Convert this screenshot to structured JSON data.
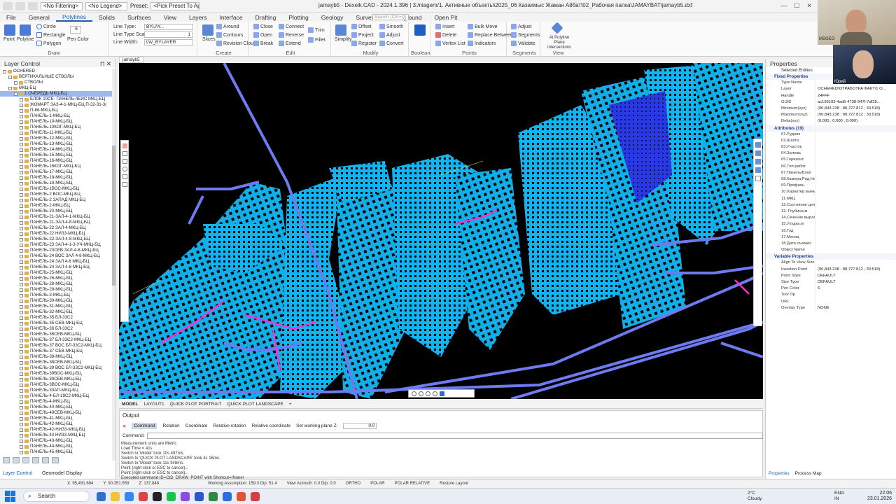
{
  "window": {
    "title": "jamayb5 - Dexeik.CAD - 2024.1.396 | 3:/niagem/1. Активные объекты\\2025_06 Казахмыс Жаман Айбат\\02_Рабочая папка\\JAMAYBAT\\jamayb5.dxf",
    "filter_label": "<No Filtering>",
    "legend_label": "<No Legend>",
    "preset_label": "Preset:",
    "preset_value": "<Pick Preset To Ap...",
    "search_placeholder": "Search (Ctrl+Q)"
  },
  "menu": {
    "items": [
      "File",
      "General",
      "Polylines",
      "Solids",
      "Surfaces",
      "View",
      "Layers",
      "Interface",
      "Drafting",
      "Plotting",
      "Geology",
      "Survey",
      "Underground",
      "Open Pit"
    ],
    "active": "Polylines"
  },
  "ribbon": {
    "draw": {
      "title": "Draw",
      "items": [
        "Point",
        "Polyline",
        "Circle",
        "Rectangle",
        "Polygon",
        "Pen Color"
      ],
      "pen_color_value": "6"
    },
    "linetype": {
      "line_type_label": "Line Type:",
      "line_type_value": "BYLAY...",
      "line_type_scale_label": "Line Type Scale:",
      "line_type_scale_value": "1",
      "line_width_label": "Line Width:",
      "line_width_value": "LW_BYLAYER"
    },
    "create": {
      "title": "Create",
      "items": [
        "Slices",
        "Around",
        "Contours",
        "Revision Cloud"
      ]
    },
    "edit": {
      "title": "Edit",
      "items": [
        "Close",
        "Open",
        "Break",
        "Connect",
        "Reverse",
        "Extend",
        "Trim",
        "Fillet"
      ]
    },
    "modify": {
      "title": "Modify",
      "items": [
        "Simplify",
        "Offset",
        "Project",
        "Register",
        "Smooth",
        "Adjust",
        "Convert"
      ]
    },
    "boolean": {
      "title": "Boolean",
      "items": [
        "Boolean"
      ]
    },
    "points": {
      "title": "Points",
      "items": [
        "Insert",
        "Delete",
        "Vertex List",
        "Bulk Move",
        "Replace Between",
        "Indicators"
      ]
    },
    "segments": {
      "title": "Segments",
      "items": [
        "Adjust",
        "Segments",
        "Validate"
      ]
    },
    "view": {
      "title": "View",
      "items": [
        "At Polyline Plane Intersections"
      ]
    }
  },
  "layer_control": {
    "title": "Layer Control",
    "tree": [
      {
        "label": "OCHERED",
        "indent": 0
      },
      {
        "label": "ВЕРТИКАЛЬНЫЕ СТВОЛЫ",
        "indent": 1
      },
      {
        "label": "СТВОЛЫ",
        "indent": 2
      },
      {
        "label": "МКЦ-БЦ",
        "indent": 1
      },
      {
        "label": "1 ОЧЕРЕДЬ МКЦ-БЦ",
        "indent": 2,
        "selected": true
      },
      {
        "label": "БЛОК 10СЕ- ПАНЕЛЬ-4БИС МКЦ-БЦ",
        "indent": 3
      },
      {
        "label": "ЖОМАРТ ЗАЗ-4-1-МКЦ-БЦ П-32-31-3(",
        "indent": 3
      },
      {
        "label": "П-86-МКЦ-БЦ",
        "indent": 3
      },
      {
        "label": "ПАНЕЛЬ-1-МКЦ-БЦ",
        "indent": 3
      },
      {
        "label": "ПАНЕЛЬ-10-МКЦ-БЦ",
        "indent": 3
      },
      {
        "label": "ПАНЕЛЬ-10КОГ-МКЦ-БЦ",
        "indent": 3
      },
      {
        "label": "ПАНЕЛЬ-11-МКЦ-БЦ",
        "indent": 3
      },
      {
        "label": "ПАНЕЛЬ-12-МКЦ-БЦ",
        "indent": 3
      },
      {
        "label": "ПАНЕЛЬ-13-МКЦ-БЦ",
        "indent": 3
      },
      {
        "label": "ПАНЕЛЬ-14-МКЦ-БЦ",
        "indent": 3
      },
      {
        "label": "ПАНЕЛЬ-15-МКЦ-БЦ",
        "indent": 3
      },
      {
        "label": "ПАНЕЛЬ-16-МКЦ-БЦ",
        "indent": 3
      },
      {
        "label": "ПАНЕЛЬ-16КОГ-МКЦ-БЦ",
        "indent": 3
      },
      {
        "label": "ПАНЕЛЬ-17-МКЦ-БЦ",
        "indent": 3
      },
      {
        "label": "ПАНЕЛЬ-18-МКЦ-БЦ",
        "indent": 3
      },
      {
        "label": "ПАНЕЛЬ-19-МКЦ-БЦ",
        "indent": 3
      },
      {
        "label": "ПАНЕЛЬ-1ВОС-МКЦ-БЦ",
        "indent": 3
      },
      {
        "label": "ПАНЕЛЬ-2 ВОС-МКЦ-БЦ",
        "indent": 3
      },
      {
        "label": "ПАНЕЛЬ-2 ЗАПАД МКЦ-БЦ",
        "indent": 3
      },
      {
        "label": "ПАНЕЛЬ-2-МКЦ-БЦ",
        "indent": 3
      },
      {
        "label": "ПАНЕЛЬ-20-МКЦ-БЦ",
        "indent": 3
      },
      {
        "label": "ПАНЕЛЬ-21-ЗАЛ-4-1-МКЦ-БЦ",
        "indent": 3
      },
      {
        "label": "ПАНЕЛЬ-21-ЗАЛ-4-8-МКЦ-БЦ",
        "indent": 3
      },
      {
        "label": "ПАНЕЛЬ-22 ЗАЛ-4-МКЦ-БЦ",
        "indent": 3
      },
      {
        "label": "ПАНЕЛЬ-22 НИЗ3-МКЦ-БЦ",
        "indent": 3
      },
      {
        "label": "ПАНЕЛЬ-22-ЗАЛ-4-8-МКЦ-БЦ",
        "indent": 3
      },
      {
        "label": "ПАНЕЛЬ-23 ЗАЛ-4-1-3-УЧ-МКЦ-БЦ",
        "indent": 3
      },
      {
        "label": "ПАНЕЛЬ-23СЕВ ЗАЛ-4-8-МКЦ-БЦ",
        "indent": 3
      },
      {
        "label": "ПАНЕЛЬ-24 ВОС ЗАЛ 4-8-МКЦ-БЦ",
        "indent": 3
      },
      {
        "label": "ПАНЕЛЬ-24 ЗАЛ 4-8 МКЦ-БЦ",
        "indent": 3
      },
      {
        "label": "ПАНЕЛЬ-24 ЗАЛ-4-8 МКЦ-БЦ",
        "indent": 3
      },
      {
        "label": "ПАНЕЛЬ-25-МКЦ-БЦ",
        "indent": 3
      },
      {
        "label": "ПАНЕЛЬ-26-МКЦ-БЦ",
        "indent": 3
      },
      {
        "label": "ПАНЕЛЬ-28-МКЦ-БЦ",
        "indent": 3
      },
      {
        "label": "ПАНЕЛЬ-29-МКЦ-БЦ",
        "indent": 3
      },
      {
        "label": "ПАНЕЛЬ-3-МКЦ-БЦ",
        "indent": 3
      },
      {
        "label": "ПАНЕЛЬ-30-МКЦ-БЦ",
        "indent": 3
      },
      {
        "label": "ПАНЕЛЬ-31-МКЦ-БЦ",
        "indent": 3
      },
      {
        "label": "ПАНЕЛЬ-32-МКЦ-БЦ",
        "indent": 3
      },
      {
        "label": "ПАНЕЛЬ-35 БЛ-33С2",
        "indent": 3
      },
      {
        "label": "ПАНЕЛЬ-35 СЕВ-МКЦ-БЦ",
        "indent": 3
      },
      {
        "label": "ПАНЕЛЬ-36 БЛ-33С2",
        "indent": 3
      },
      {
        "label": "ПАНЕЛЬ-36СЕВ-МКЦ-БЦ",
        "indent": 3
      },
      {
        "label": "ПАНЕЛЬ-37 БЛ-33С2-МКЦ-БЦ",
        "indent": 3
      },
      {
        "label": "ПАНЕЛЬ-37 ВОС БЛ-33С2-МКЦ-БЦ",
        "indent": 3
      },
      {
        "label": "ПАНЕЛЬ-37 СЕВ-МКЦ-БЦ",
        "indent": 3
      },
      {
        "label": "ПАНЕЛЬ-38-МКЦ-БЦ",
        "indent": 3
      },
      {
        "label": "ПАНЕЛЬ-38СЕВ-МКЦ-БЦ",
        "indent": 3
      },
      {
        "label": "ПАНЕЛЬ-39 ВОС БЛ-33С2-МКЦ-БЦ",
        "indent": 3
      },
      {
        "label": "ПАНЕЛЬ-39ВОС-МКЦ-БЦ",
        "indent": 3
      },
      {
        "label": "ПАНЕЛЬ-39СЕВ-МКЦ-БЦ",
        "indent": 3
      },
      {
        "label": "ПАНЕЛЬ-3ВОС-МКЦ-БЦ",
        "indent": 3
      },
      {
        "label": "ПАНЕЛЬ-33АП-МКЦ-БЦ",
        "indent": 3
      },
      {
        "label": "ПАНЕЛЬ-4-БЛ-19С2-МКЦ-БЦ",
        "indent": 3
      },
      {
        "label": "ПАНЕЛЬ-4-МКЦ-БЦ",
        "indent": 3
      },
      {
        "label": "ПАНЕЛЬ-40-МКЦ-БЦ",
        "indent": 3
      },
      {
        "label": "ПАНЕЛЬ-40СЕВ-МКЦ-БЦ",
        "indent": 3
      },
      {
        "label": "ПАНЕЛЬ-41-МКЦ-БЦ",
        "indent": 3
      },
      {
        "label": "ПАНЕЛЬ-42-МКЦ-БЦ",
        "indent": 3
      },
      {
        "label": "ПАНЕЛЬ-42-НИЗ3-МКЦ-БЦ",
        "indent": 3
      },
      {
        "label": "ПАНЕЛЬ-43 НИЗ3-МКЦ-БЦ",
        "indent": 3
      },
      {
        "label": "ПАНЕЛЬ-43-МКЦ-БЦ",
        "indent": 3
      },
      {
        "label": "ПАНЕЛЬ-44-МКЦ-БЦ",
        "indent": 3
      },
      {
        "label": "ПАНЕЛЬ-45-МКЦ-БЦ",
        "indent": 3
      }
    ],
    "tabs": [
      "Layer Control",
      "Geomodel Display"
    ],
    "active_tab": "Layer Control"
  },
  "viewport": {
    "file_tab": "jamayb5",
    "layout_tabs": [
      "MODEL",
      "LAYOUT1",
      "QUICK PLOT PORTRAIT",
      "QUICK PLOT LANDSCAPE"
    ],
    "colors": {
      "background": "#000000",
      "workings": "#0fb4f0",
      "roads": "#6e7bf0",
      "dense": "#2a3ae0",
      "highlight": "#ff2fd0"
    }
  },
  "output": {
    "title": "Output",
    "tabs": [
      "Command",
      "Rotation",
      "Coordinate",
      "Relative rotation",
      "Relative coordinate",
      "Set working plane Z:"
    ],
    "active_tab": "Command",
    "working_plane_value": "0.0",
    "command_label": "Command:",
    "log": [
      "Measurement units are Metric",
      "Load Time = 41s",
      "Switch to 'Model' took 10s 497ms.",
      "Switch to 'QUICK PLOT LANDSCAPE' took 4s 16ms.",
      "Switch to 'Model' took 11s 948ms.",
      "Point (right-click or ESC to cancel)...",
      "Point (right-click or ESC to cancel)...",
      "Executed command ID=CID_DRAW_POINT with Shortcut=(None)"
    ]
  },
  "properties": {
    "title": "Properties",
    "selected_entities": "Selected Entities",
    "fixed_title": "Fixed Properties",
    "fixed": [
      {
        "k": "Type Name",
        "v": ""
      },
      {
        "k": "Layer",
        "v": "OCHERED\\ОТРАБОТКА ФАКТ\\1 О..."
      },
      {
        "k": "Handle",
        "v": "24FFF"
      },
      {
        "k": "GUID",
        "v": "ac196103-4ad6-4738-947f-7df25..."
      },
      {
        "k": "Minimum(xyz)",
        "v": "(90,843.238 ; 88,727.812 ; 30.518)"
      },
      {
        "k": "Maximum(xyz)",
        "v": "(90,843.238 ; 88,727.812 ; 30.518)"
      },
      {
        "k": "Delta(xyz)",
        "v": "(0.000 ; 0.000 ; 0.000)"
      }
    ],
    "attributes_title": "Attributes (19)",
    "attributes": [
      "01.Рудник",
      "02.Шахта",
      "03.Участок",
      "04.Залежь",
      "05.Горизонт",
      "06.Тип работ",
      "07.Панель/Блок",
      "08.Камера,Ряд,Наименование",
      "09.Профиль",
      "10.Характер выемочной",
      "11.МКЦ",
      "12.Состояние целика",
      "13. Глубина,м",
      "14.Сечение выработки,м",
      "15.Ухудка,м",
      "16.Год",
      "17.Месяц",
      "18.Дата съемки",
      "Object Name"
    ],
    "variable_title": "Variable Properties",
    "variable": [
      {
        "k": "Align To View Size",
        "v": ""
      },
      {
        "k": "Insertion Point",
        "v": "(90,843.238 ; 88,727.812 ; 30.518)"
      },
      {
        "k": "Point Style",
        "v": "DEFAULT"
      },
      {
        "k": "Size Type",
        "v": "DEFAULT"
      },
      {
        "k": "Pen Color",
        "v": "6"
      },
      {
        "k": "Tool Tip",
        "v": ""
      },
      {
        "k": "URL",
        "v": ""
      },
      {
        "k": "Overlay Type",
        "v": "NONE"
      }
    ],
    "tabs": [
      "Properties",
      "Process Map"
    ]
  },
  "status": {
    "x": "X: 95,491.684",
    "y": "Y: 90,351.559",
    "z": "Z: 137,848",
    "working_assumption": "Working Assumption: 159.3 Dip: 51.4",
    "view_azimuth": "View Azimuth: 0.0 Dip: 0.0",
    "ortho": "ORTHO",
    "polar": "POLAR",
    "polar_relative": "POLAR RELATIVE",
    "restore_layout": "Restore Layout"
  },
  "taskbar": {
    "search": "Search",
    "weather_temp": "2°C",
    "weather_desc": "Cloudy",
    "lang": "ENG",
    "lang2": "IN",
    "time": "22:06",
    "date": "23.01.2026"
  },
  "webcam": {
    "name1": "MSGEO",
    "name2": "Юрий"
  }
}
